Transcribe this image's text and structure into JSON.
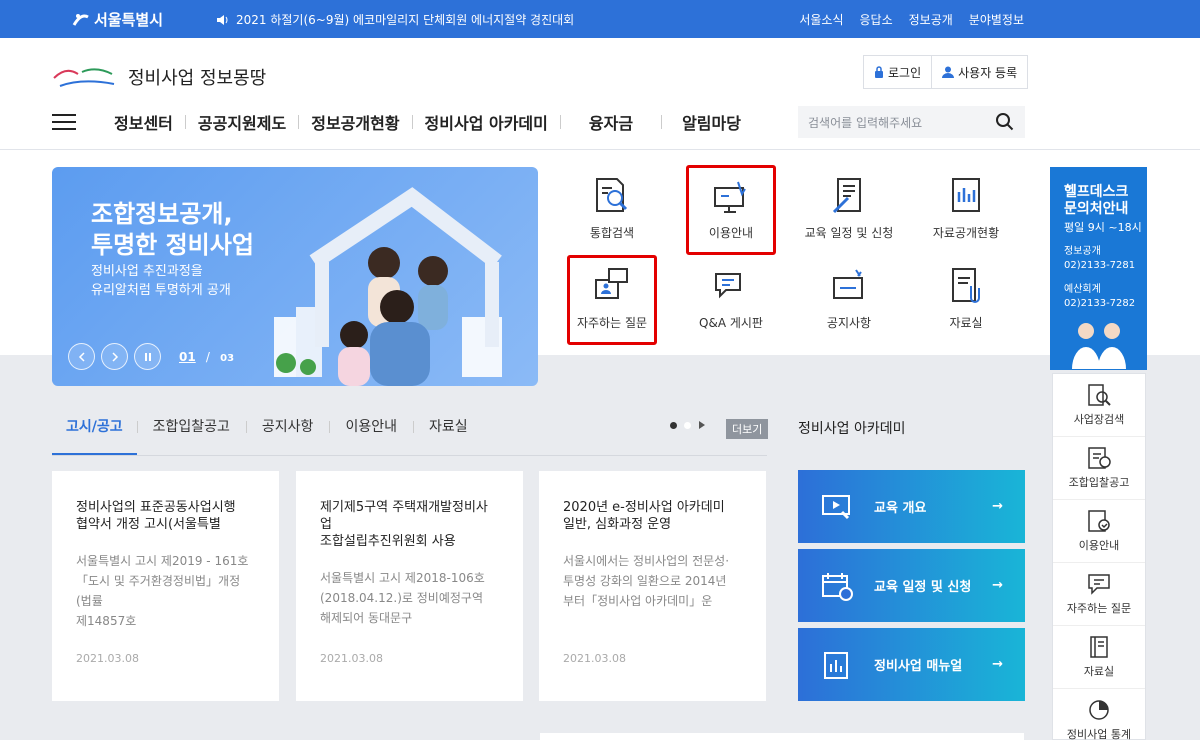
{
  "topbar": {
    "logo": "서울특별시",
    "notice": "2021 하절기(6~9월) 에코마일리지 단체회원 에너지절약 경진대회",
    "links": [
      "서울소식",
      "응답소",
      "정보공개",
      "분야별정보"
    ]
  },
  "header": {
    "brand_title": "정비사업 정보몽땅",
    "login": "로그인",
    "register": "사용자 등록",
    "menu": [
      "정보센터",
      "공공지원제도",
      "정보공개현황",
      "정비사업 아카데미",
      "융자금",
      "알림마당"
    ],
    "search_placeholder": "검색어를 입력해주세요"
  },
  "hero": {
    "title": "조합정보공개,\n투명한 정비사업",
    "subtitle": "정비사업 추진과정을\n유리알처럼 투명하게 공개",
    "page_current": "01",
    "page_sep": "/",
    "page_total": "03"
  },
  "quick": [
    "통합검색",
    "이용안내",
    "교육 일정 및 신청",
    "자료공개현황",
    "자주하는 질문",
    "Q&A 게시판",
    "공지사항",
    "자료실"
  ],
  "help": {
    "title1": "헬프데스크",
    "title2": "문의처안내",
    "hours": "평일 9시 ~18시",
    "l1a": "정보공개",
    "l1b": "02)2133-7281",
    "l2a": "예산회계",
    "l2b": "02)2133-7282"
  },
  "side": [
    "사업장검색",
    "조합입찰공고",
    "이용안내",
    "자주하는 질문",
    "자료실",
    "정비사업 통계"
  ],
  "tabs": [
    "고시/공고",
    "조합입찰공고",
    "공지사항",
    "이용안내",
    "자료실"
  ],
  "more": "더보기",
  "cards": [
    {
      "title": "정비사업의 표준공동사업시행\n협약서 개정 고시(서울특별",
      "body": "서울특별시 고시 제2019 - 161호\n「도시 및 주거환경정비법」개정(법률\n제14857호",
      "date": "2021.03.08"
    },
    {
      "title": "제기제5구역 주택재개발정비사업\n조합설립추진위원회 사용",
      "body": "서울특별시 고시 제2018-106호\n(2018.04.12.)로 정비예정구역\n해제되어 동대문구",
      "date": "2021.03.08"
    },
    {
      "title": "2020년 e-정비사업 아카데미\n일반, 심화과정 운영",
      "body": "서울시에서는 정비사업의 전문성·\n투명성 강화의 일환으로 2014년\n부터「정비사업 아카데미」운",
      "date": "2021.03.08"
    }
  ],
  "academy": {
    "title": "정비사업 아카데미",
    "items": [
      "교육 개요",
      "교육 일정 및 신청",
      "정비사업 매뉴얼"
    ],
    "arrow": "→"
  },
  "colors": {
    "primary": "#2d71d8",
    "highlight": "#e30000",
    "help": "#1a78d6"
  }
}
